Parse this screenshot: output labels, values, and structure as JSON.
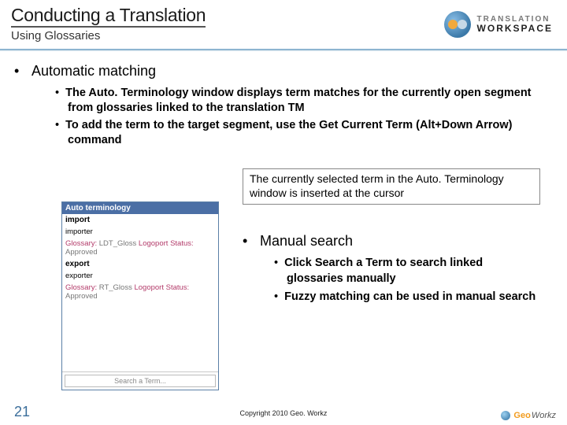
{
  "header": {
    "title": "Conducting a Translation",
    "subtitle": "Using Glossaries",
    "brand_top": "TRANSLATION",
    "brand_bottom": "WORKSPACE"
  },
  "content": {
    "l1_auto": "Automatic matching",
    "l2_auto": [
      "The Auto. Terminology window displays term matches for the currently open segment from glossaries linked to the translation TM",
      "To add the term to the target segment, use the Get Current Term (Alt+Down Arrow) command"
    ],
    "callout": "The currently selected term in the Auto. Terminology window is inserted at the cursor",
    "l1_manual": "Manual search",
    "l2_manual": [
      "Click Search a Term to search linked glossaries manually",
      "Fuzzy matching can be used in manual search"
    ]
  },
  "autoterm": {
    "title": "Auto terminology",
    "entries": [
      {
        "term": "import",
        "trans": "importer",
        "glossary": "LDT_Gloss",
        "logoport_status": "Approved"
      },
      {
        "term": "export",
        "trans": "exporter",
        "glossary": "RT_Gloss",
        "logoport_status": "Approved"
      }
    ],
    "glossary_label": "Glossary:",
    "status_label": "Logoport Status:",
    "search_placeholder": "Search a Term..."
  },
  "footer": {
    "page": "21",
    "copyright": "Copyright 2010 Geo. Workz",
    "gw_geo": "Geo",
    "gw_workz": "Workz"
  }
}
